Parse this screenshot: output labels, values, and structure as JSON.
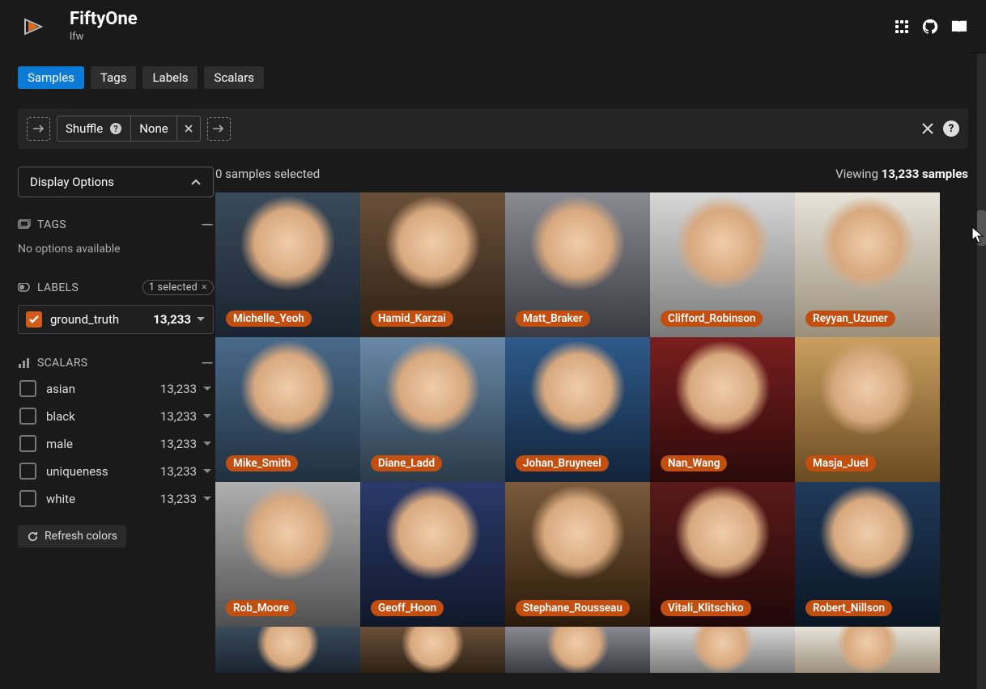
{
  "header": {
    "app_title": "FiftyOne",
    "dataset": "lfw"
  },
  "tabs": {
    "samples": "Samples",
    "tags": "Tags",
    "labels": "Labels",
    "scalars": "Scalars"
  },
  "query": {
    "shuffle_label": "Shuffle",
    "shuffle_value": "None"
  },
  "display_options_label": "Display Options",
  "tags_section": {
    "title": "TAGS",
    "empty_text": "No options available"
  },
  "labels_section": {
    "title": "LABELS",
    "selected_badge": "1 selected",
    "ground_truth": {
      "name": "ground_truth",
      "count": "13,233"
    }
  },
  "scalars_section": {
    "title": "SCALARS",
    "items": [
      {
        "name": "asian",
        "count": "13,233"
      },
      {
        "name": "black",
        "count": "13,233"
      },
      {
        "name": "male",
        "count": "13,233"
      },
      {
        "name": "uniqueness",
        "count": "13,233"
      },
      {
        "name": "white",
        "count": "13,233"
      }
    ]
  },
  "refresh_label": "Refresh colors",
  "status": {
    "selected_text": "0 samples selected",
    "viewing_prefix": "Viewing ",
    "count": "13,233",
    "viewing_suffix": " samples"
  },
  "grid": {
    "rows": [
      [
        "Michelle_Yeoh",
        "Hamid_Karzai",
        "Matt_Braker",
        "Clifford_Robinson",
        "Reyyan_Uzuner"
      ],
      [
        "Mike_Smith",
        "Diane_Ladd",
        "Johan_Bruyneel",
        "Nan_Wang",
        "Masja_Juel"
      ],
      [
        "Rob_Moore",
        "Geoff_Hoon",
        "Stephane_Rousseau",
        "Vitali_Klitschko",
        "Robert_Nillson"
      ]
    ]
  }
}
